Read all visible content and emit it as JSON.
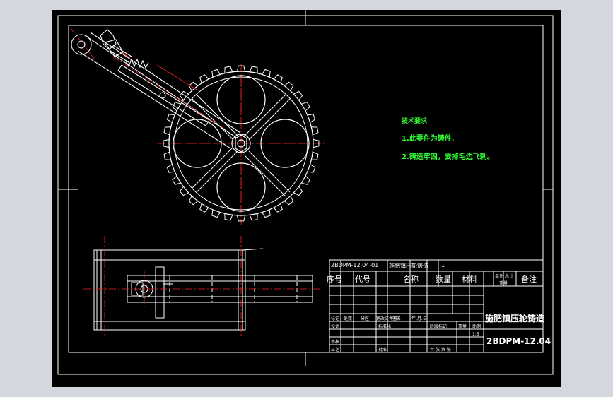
{
  "tech_requirements": {
    "title": "技术要求",
    "items": [
      "1.此零件为铸件.",
      "2.铸造牢固，去掉毛边飞刺。"
    ]
  },
  "parts_list": {
    "row1": {
      "code": "2BDPM-12.04-01",
      "name": "施肥镇压轮铸造",
      "qty": "1"
    },
    "header": {
      "seq": "序号",
      "code": "代号",
      "name": "名称",
      "qty": "数量",
      "material": "材料",
      "unit_weight": "单件",
      "total_weight": "总计",
      "weight_label": "重量",
      "remark": "备注"
    }
  },
  "title_block": {
    "part_name": "施肥镇压轮铸造",
    "drawing_number": "2BDPM-12.04",
    "scale": "1:5",
    "stage_mark": "阶段标记",
    "weight": "重量",
    "ratio": "比例",
    "sheets": "共 张 第 张",
    "sign_labels": [
      "标记",
      "处数",
      "分区",
      "更改文件号",
      "签名",
      "年.月.日"
    ],
    "row_labels": [
      "设计",
      "审核",
      "工艺"
    ],
    "std_label": "标准化",
    "approve_label": "批准"
  },
  "colors": {
    "background": "#000000",
    "frame": "#ffffff",
    "outline": "#ffffff",
    "centerline": "#ff2222",
    "dimension": "#ff2222",
    "notes": "#33ff33",
    "app_bg": "#d4d8de"
  }
}
